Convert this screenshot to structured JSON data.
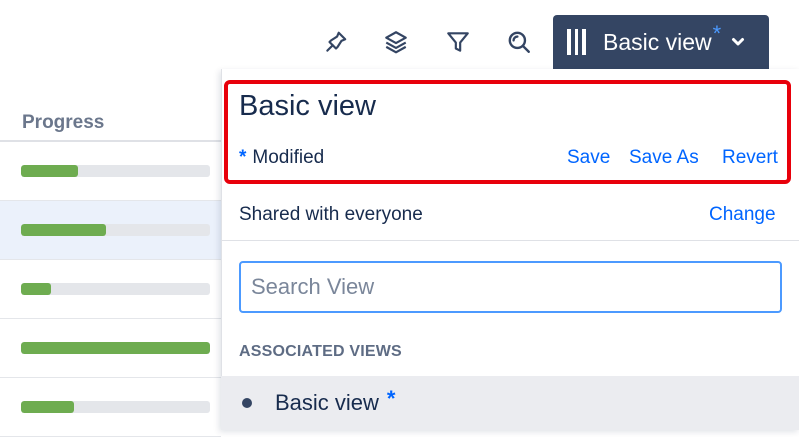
{
  "toolbar": {
    "icons": [
      "pin-icon",
      "layers-icon",
      "filter-icon",
      "search-icon"
    ],
    "view_button_label": "Basic view",
    "view_button_modified_marker": "*",
    "accent_color": "#344563"
  },
  "table": {
    "column_header": "Progress",
    "rows": [
      {
        "progress": 0.3,
        "selected": false
      },
      {
        "progress": 0.45,
        "selected": true
      },
      {
        "progress": 0.16,
        "selected": false
      },
      {
        "progress": 1.0,
        "selected": false
      },
      {
        "progress": 0.28,
        "selected": false
      }
    ],
    "bar_color": "#6eac50"
  },
  "view_panel": {
    "title": "Basic view",
    "modified_marker": "*",
    "modified_label": "Modified",
    "actions": {
      "save": "Save",
      "save_as": "Save As",
      "revert": "Revert"
    },
    "shared_text": "Shared with everyone",
    "change_link": "Change",
    "search_placeholder": "Search View",
    "associated_header": "ASSOCIATED VIEWS",
    "associated_views": [
      {
        "name": "Basic view",
        "modified_marker": "*"
      }
    ],
    "highlight_color": "#e8000b",
    "link_color": "#0065ff"
  }
}
